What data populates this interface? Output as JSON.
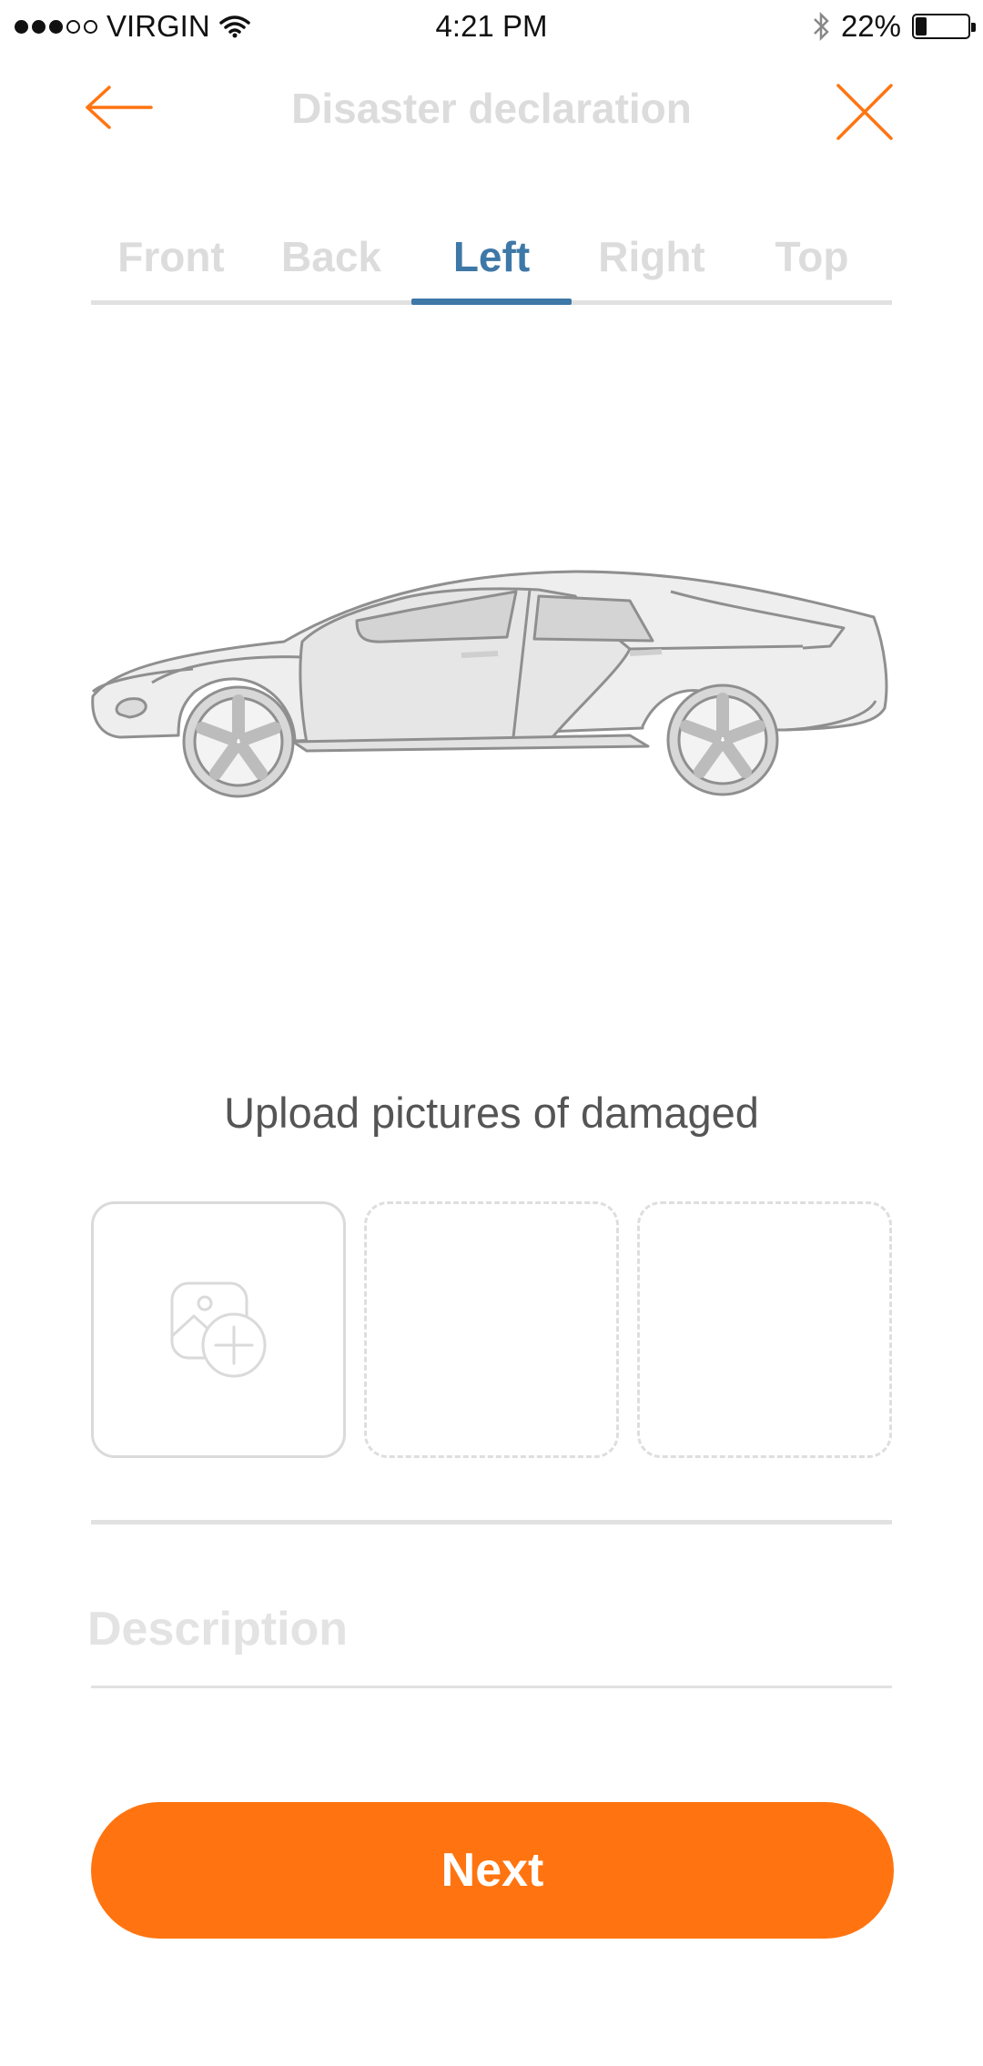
{
  "status_bar": {
    "carrier": "VIRGIN",
    "time": "4:21 PM",
    "battery": "22%",
    "battery_level": 0.22,
    "signal_bars_filled": 3,
    "signal_bars_total": 5
  },
  "header": {
    "title": "Disaster declaration",
    "back_icon": "arrow-left-icon",
    "close_icon": "close-icon"
  },
  "tabs": [
    {
      "label": "Front",
      "active": false
    },
    {
      "label": "Back",
      "active": false
    },
    {
      "label": "Left",
      "active": true
    },
    {
      "label": "Right",
      "active": false
    },
    {
      "label": "Top",
      "active": false
    }
  ],
  "upload": {
    "label": "Upload pictures of damaged",
    "add_icon": "add-photo-icon",
    "slots": [
      "add",
      "empty",
      "empty"
    ]
  },
  "description": {
    "placeholder": "Description",
    "value": ""
  },
  "next_button": {
    "label": "Next"
  },
  "colors": {
    "accent": "#ff7410",
    "active_tab": "#3e78a7",
    "inactive_text": "#dcdcdc"
  }
}
